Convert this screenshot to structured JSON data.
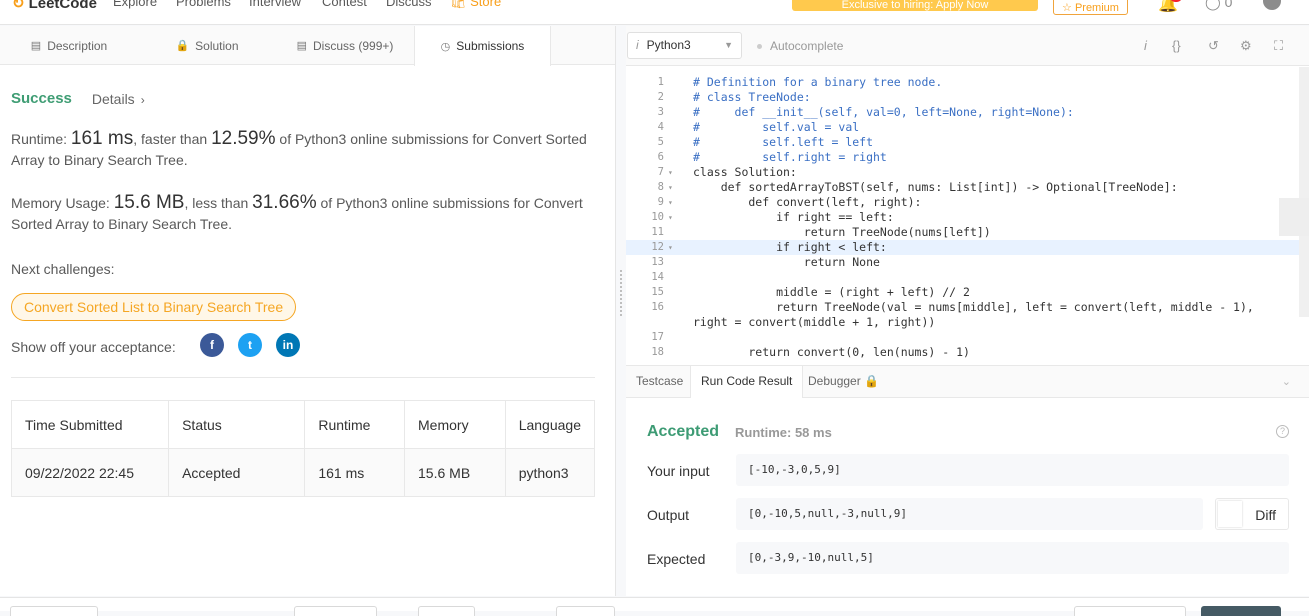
{
  "topnav": {
    "logo": "LeetCode",
    "links": [
      "Explore",
      "Problems",
      "Interview",
      "Contest",
      "Discuss"
    ],
    "store": "Store",
    "promo": "Exclusive to hiring: Apply Now",
    "premium": "Premium",
    "coins": "0"
  },
  "left_tabs": [
    "Description",
    "Solution",
    "Discuss (999+)",
    "Submissions"
  ],
  "result": {
    "status": "Success",
    "details": "Details",
    "runtime_label": "Runtime: ",
    "runtime_value": "161 ms",
    "runtime_mid": ", faster than ",
    "runtime_pct": "12.59%",
    "runtime_tail": " of Python3 online submissions for Convert Sorted Array to Binary Search Tree.",
    "memory_label": "Memory Usage: ",
    "memory_value": "15.6 MB",
    "memory_mid": ", less than ",
    "memory_pct": "31.66%",
    "memory_tail": " of Python3 online submissions for Convert Sorted Array to Binary Search Tree.",
    "next_label": "Next challenges:",
    "next_challenge": "Convert Sorted List to Binary Search Tree",
    "share_label": "Show off your acceptance:"
  },
  "submissions": {
    "headers": [
      "Time Submitted",
      "Status",
      "Runtime",
      "Memory",
      "Language"
    ],
    "rows": [
      [
        "09/22/2022 22:45",
        "Accepted",
        "161 ms",
        "15.6 MB",
        "python3"
      ]
    ]
  },
  "editor": {
    "language": "Python3",
    "autocomplete": "Autocomplete",
    "lines": [
      {
        "n": "1",
        "text": "# Definition for a binary tree node.",
        "cls": "cm"
      },
      {
        "n": "2",
        "text": "# class TreeNode:",
        "cls": "cm"
      },
      {
        "n": "3",
        "text": "#     def __init__(self, val=0, left=None, right=None):",
        "cls": "cm"
      },
      {
        "n": "4",
        "text": "#         self.val = val",
        "cls": "cm"
      },
      {
        "n": "5",
        "text": "#         self.left = left",
        "cls": "cm"
      },
      {
        "n": "6",
        "text": "#         self.right = right",
        "cls": "cm"
      },
      {
        "n": "7",
        "text": "class Solution:",
        "cls": ""
      },
      {
        "n": "8",
        "text": "    def sortedArrayToBST(self, nums: List[int]) -> Optional[TreeNode]:",
        "cls": ""
      },
      {
        "n": "9",
        "text": "        def convert(left, right):",
        "cls": ""
      },
      {
        "n": "10",
        "text": "            if right == left:",
        "cls": ""
      },
      {
        "n": "11",
        "text": "                return TreeNode(nums[left])",
        "cls": ""
      },
      {
        "n": "12",
        "text": "            if right < left:",
        "cls": ""
      },
      {
        "n": "13",
        "text": "                return None",
        "cls": ""
      },
      {
        "n": "14",
        "text": "",
        "cls": ""
      },
      {
        "n": "15",
        "text": "            middle = (right + left) // 2",
        "cls": ""
      },
      {
        "n": "16",
        "text": "            return TreeNode(val = nums[middle], left = convert(left, middle - 1),",
        "cls": ""
      },
      {
        "n": "",
        "text": "right = convert(middle + 1, right))",
        "cls": "wrap"
      },
      {
        "n": "17",
        "text": "",
        "cls": ""
      },
      {
        "n": "18",
        "text": "        return convert(0, len(nums) - 1)",
        "cls": ""
      }
    ],
    "folded_lines": [
      "7",
      "8",
      "9",
      "10",
      "12"
    ],
    "highlighted_line": "12"
  },
  "console": {
    "tabs": [
      "Testcase",
      "Run Code Result",
      "Debugger"
    ],
    "status": "Accepted",
    "runtime": "Runtime: 58 ms",
    "input_label": "Your input",
    "input_value": "[-10,-3,0,5,9]",
    "output_label": "Output",
    "output_value": "[0,-10,5,null,-3,null,9]",
    "expected_label": "Expected",
    "expected_value": "[0,-3,9,-10,null,5]",
    "diff_label": "Diff"
  },
  "colors": {
    "success": "#3d9b74",
    "brand": "#f89f1b",
    "comment": "#3a6fc4",
    "highlight_line": "#e8f2ff"
  }
}
